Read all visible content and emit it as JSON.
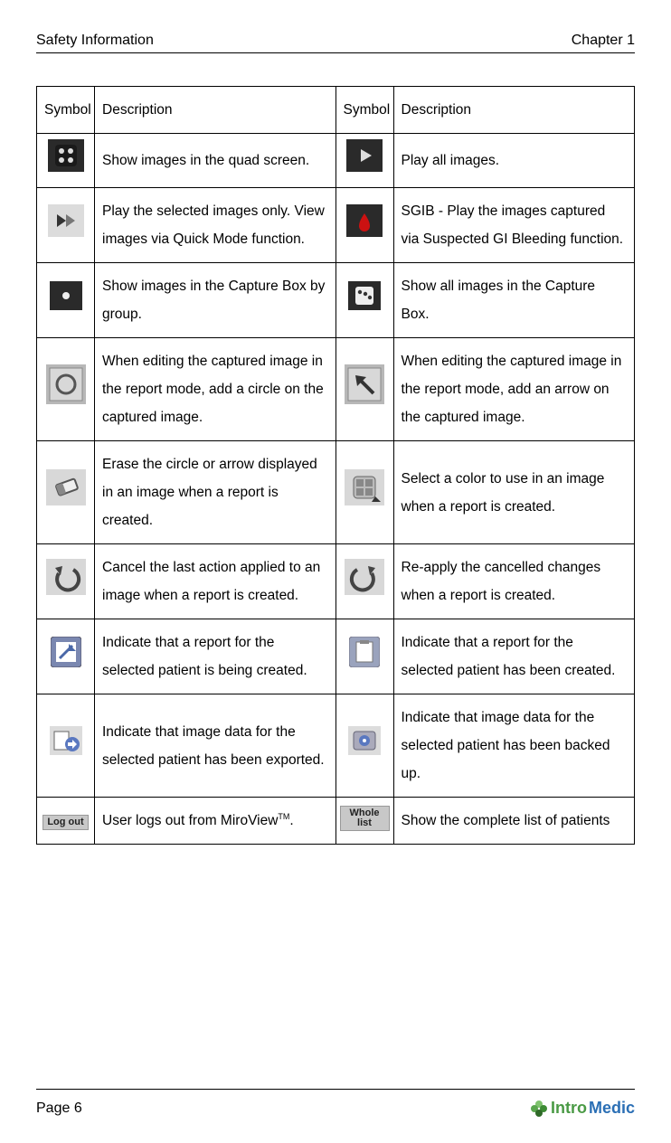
{
  "header": {
    "left": "Safety Information",
    "right": "Chapter 1"
  },
  "columns": {
    "symbol": "Symbol",
    "description": "Description"
  },
  "rows": [
    {
      "left_desc": "Show images in the quad screen.",
      "right_desc": "Play all images."
    },
    {
      "left_desc": "Play the selected images only. View images via Quick Mode function.",
      "right_desc": "SGIB - Play the images captured via Suspected GI Bleeding function."
    },
    {
      "left_desc": "Show images in the Capture Box by group.",
      "right_desc": "Show all images in the Capture Box."
    },
    {
      "left_desc": "When editing the captured image in the report mode, add a circle on the captured image.",
      "right_desc": "When editing the captured image in the report mode, add an arrow on the captured image."
    },
    {
      "left_desc": "Erase the circle or arrow displayed in an image when a report is created.",
      "right_desc": "Select a color to use in an image when a report is created."
    },
    {
      "left_desc": "Cancel the last action applied to an image when a report is created.",
      "right_desc": "Re-apply the cancelled changes when a report is created."
    },
    {
      "left_desc": "Indicate that a report for the selected patient is being created.",
      "right_desc": "Indicate that a report for the selected patient has been created."
    },
    {
      "left_desc": "Indicate that image data for the selected patient has been exported.",
      "right_desc": "Indicate that image data for the selected patient has been backed up."
    },
    {
      "left_desc": "User logs out from MiroView",
      "left_suffix": ".",
      "right_desc": "Show the complete list of patients"
    }
  ],
  "buttons": {
    "logout": "Log out",
    "wholelist": "Whole list"
  },
  "footer": {
    "page": "Page 6",
    "brand_intro": "Intro",
    "brand_medic": "Medic"
  },
  "tm": "TM"
}
